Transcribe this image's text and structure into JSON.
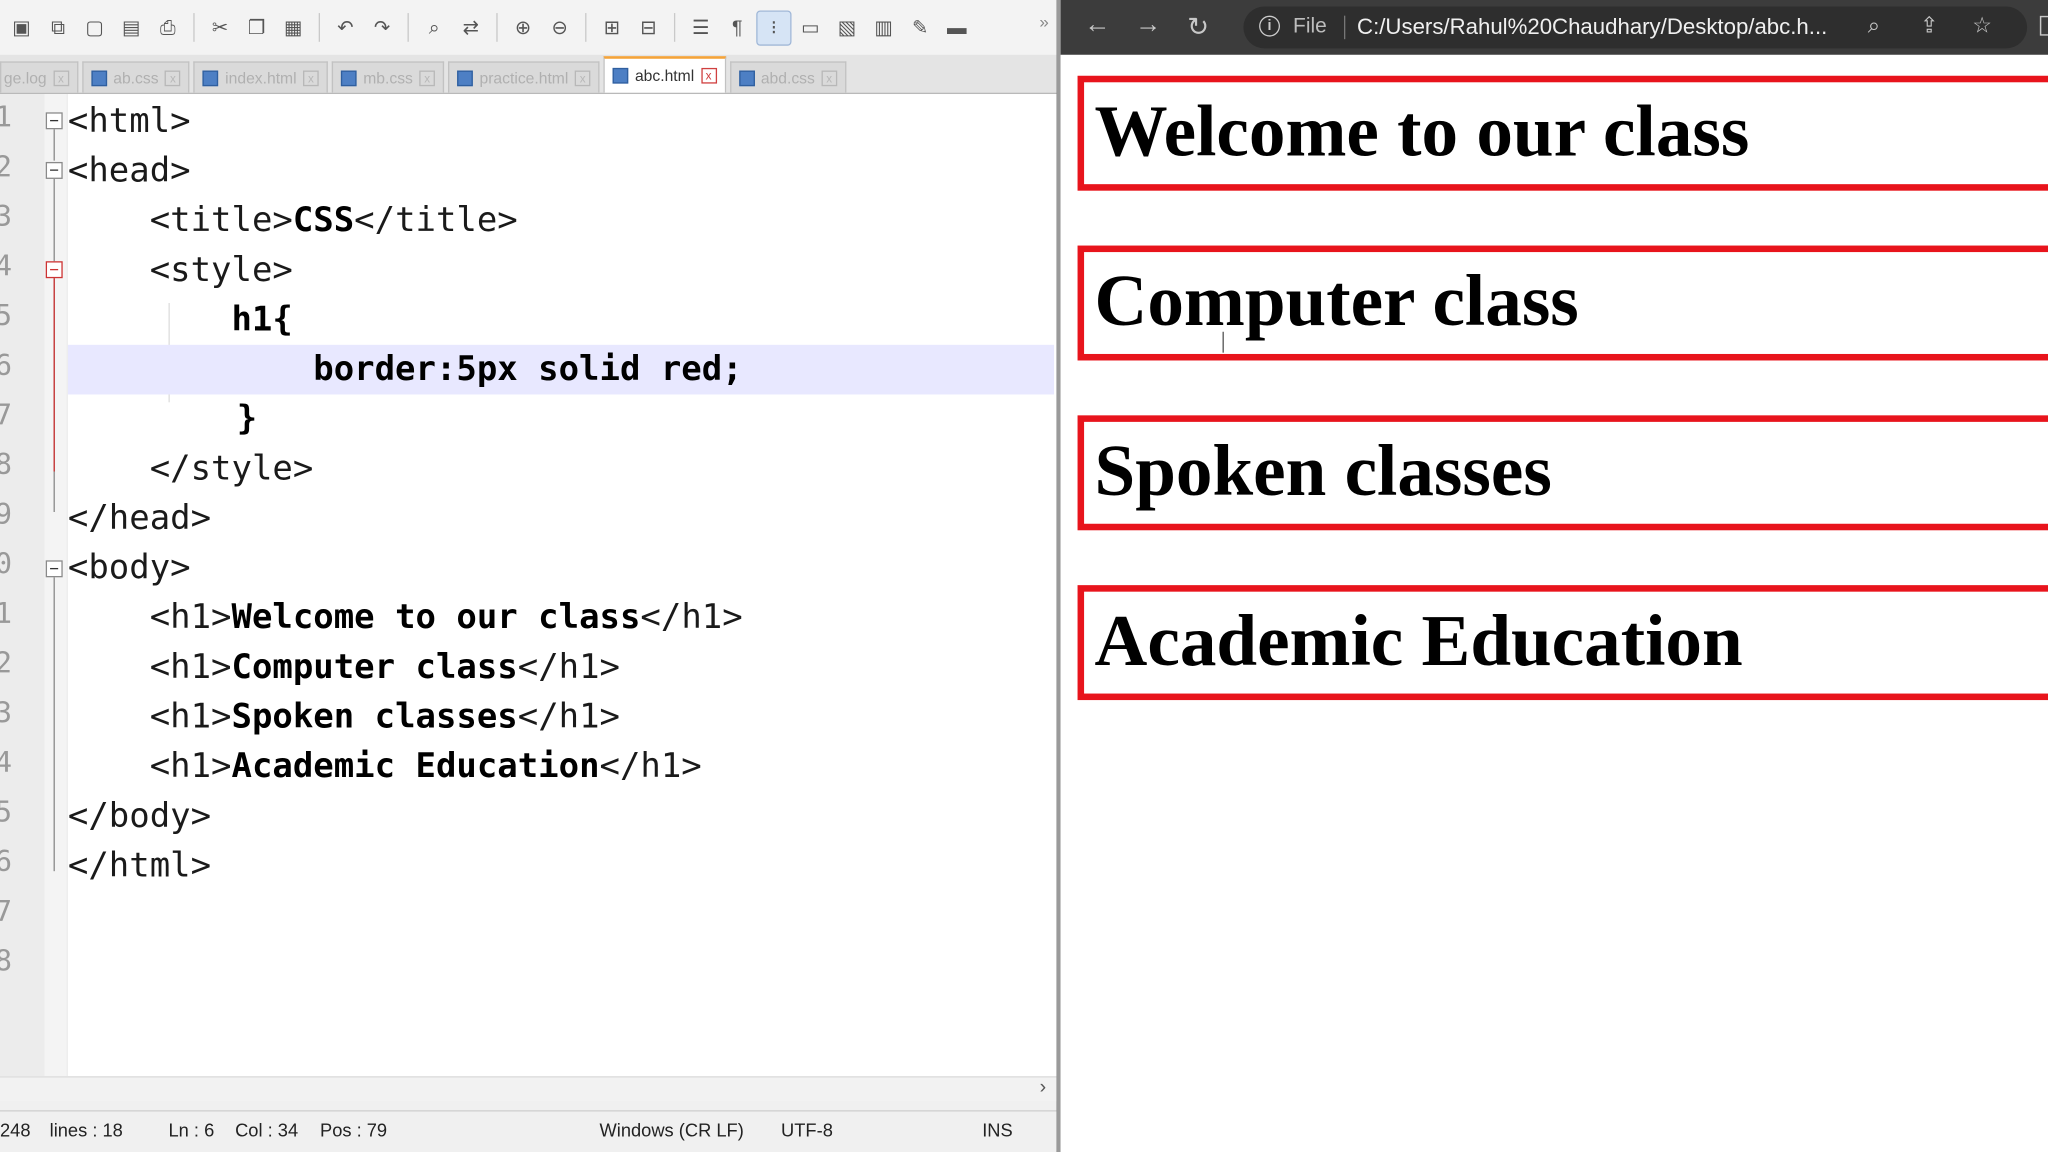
{
  "editor": {
    "tabs": [
      {
        "label": "ge.log",
        "active": false
      },
      {
        "label": "ab.css",
        "active": false
      },
      {
        "label": "index.html",
        "active": false
      },
      {
        "label": "mb.css",
        "active": false
      },
      {
        "label": "practice.html",
        "active": false
      },
      {
        "label": "abc.html",
        "active": true
      },
      {
        "label": "abd.css",
        "active": false
      }
    ],
    "line_numbers": [
      "1",
      "2",
      "3",
      "4",
      "5",
      "6",
      "7",
      "8",
      "9",
      "0",
      "1",
      "2",
      "3",
      "4",
      "5",
      "6",
      "7",
      "8"
    ],
    "code": {
      "l1_tag": "<html>",
      "l2_tag": "<head>",
      "l3_open": "<title>",
      "l3_text": "CSS",
      "l3_close": "</title>",
      "l4_tag": "<style>",
      "l5_text": "h1{",
      "l6_text": "border:5px solid red;",
      "l7_text": "}",
      "l8_tag": "</style>",
      "l9_tag": "</head>",
      "l10_tag": "<body>",
      "l11_open": "<h1>",
      "l11_text": "Welcome to our class",
      "l11_close": "</h1>",
      "l12_open": "<h1>",
      "l12_text": "Computer class",
      "l12_close": "</h1>",
      "l13_open": "<h1>",
      "l13_text": "Spoken classes",
      "l13_close": "</h1>",
      "l14_open": "<h1>",
      "l14_text": "Academic Education",
      "l14_close": "</h1>",
      "l15_tag": "</body>",
      "l16_tag": "</html>"
    },
    "status": {
      "length": "248",
      "lines": "lines : 18",
      "ln": "Ln : 6",
      "col": "Col : 34",
      "pos": "Pos : 79",
      "eol": "Windows (CR LF)",
      "encoding": "UTF-8",
      "mode": "INS"
    }
  },
  "browser": {
    "file_label": "File",
    "url": "C:/Users/Rahul%20Chaudhary/Desktop/abc.h...",
    "headings": [
      "Welcome to our class",
      "Computer class",
      "Spoken classes",
      "Academic Education"
    ],
    "border_color": "#e8141c"
  }
}
